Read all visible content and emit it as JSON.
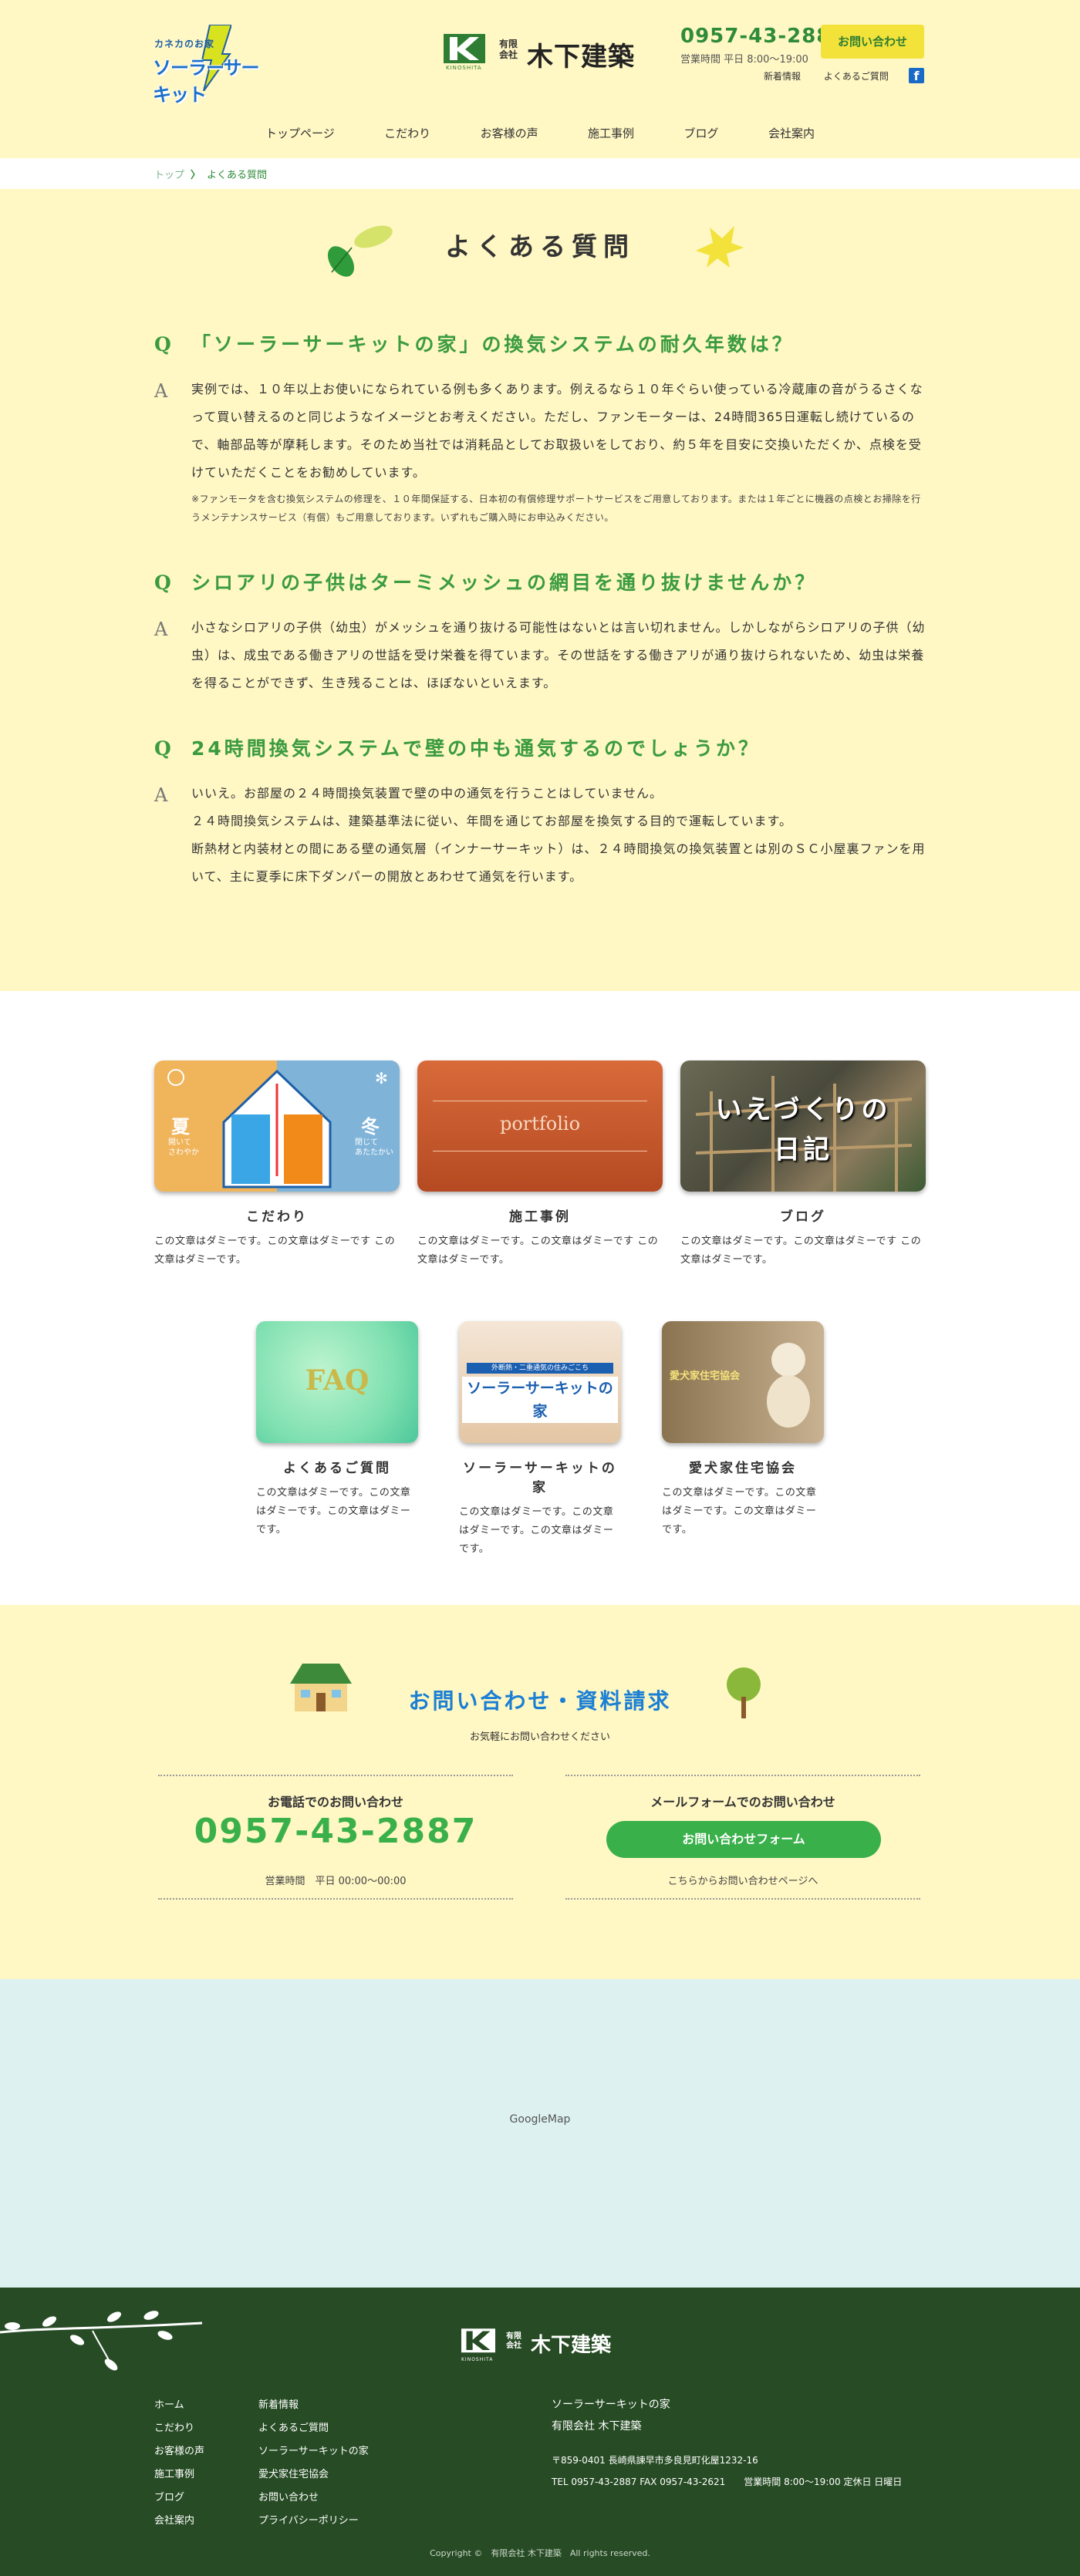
{
  "header": {
    "solar_logo_small": "カネカのお家",
    "solar_logo_big": "ソーラーサーキット",
    "company_kk": "有限\n会社",
    "company_name": "木下建築",
    "company_sub": "KINOSHITA",
    "tel": "0957-43-2887",
    "hours": "営業時間 平日 8:00〜19:00",
    "contact_button": "お問い合わせ",
    "link_news": "新着情報",
    "link_faq": "よくあるご質問",
    "facebook": "f"
  },
  "nav": [
    "トップページ",
    "こだわり",
    "お客様の声",
    "施工事例",
    "ブログ",
    "会社案内"
  ],
  "breadcrumb": {
    "home": "トップ",
    "sep": "〉",
    "current": "よくある質問"
  },
  "faq": {
    "title": "よくある質問",
    "q_mark": "Q",
    "a_mark": "A",
    "items": [
      {
        "q": "「ソーラーサーキットの家」の換気システムの耐久年数は？",
        "a": "実例では、１０年以上お使いになられている例も多くあります。例えるなら１０年ぐらい使っている冷蔵庫の音がうるさくなって買い替えるのと同じようなイメージとお考えください。ただし、ファンモーターは、24時間365日運転し続けているので、軸部品等が摩耗します。そのため当社では消耗品としてお取扱いをしており、約５年を目安に交換いただくか、点検を受けていただくことをお勧めしています。",
        "note": "※ファンモータを含む換気システムの修理を、１０年間保証する、日本初の有償修理サポートサービスをご用意しております。または１年ごとに機器の点検とお掃除を行うメンテナンスサービス（有償）もご用意しております。いずれもご購入時にお申込みください。"
      },
      {
        "q": "シロアリの子供はターミメッシュの網目を通り抜けませんか？",
        "a": "小さなシロアリの子供（幼虫）がメッシュを通り抜ける可能性はないとは言い切れません。しかしながらシロアリの子供（幼虫）は、成虫である働きアリの世話を受け栄養を得ています。その世話をする働きアリが通り抜けられないため、幼虫は栄養を得ることができず、生き残ることは、ほぼないといえます。",
        "note": ""
      },
      {
        "q": "24時間換気システムで壁の中も通気するのでしょうか？",
        "a1": "いいえ。お部屋の２４時間換気装置で壁の中の通気を行うことはしていません。",
        "a2": "２４時間換気システムは、建築基準法に従い、年間を通じてお部屋を換気する目的で運転しています。",
        "a3": "断熱材と内装材との間にある壁の通気層（インナーサーキット）は、２４時間換気の換気装置とは別のＳＣ小屋裏ファンを用いて、主に夏季に床下ダンパーの開放とあわせて通気を行います。"
      }
    ]
  },
  "cards": [
    {
      "title": "こだわり",
      "desc": "この文章はダミーです。この文章はダミーです この文章はダミーです。",
      "img_summer": "夏",
      "img_summer_sub": "開いて\nさわやか",
      "img_winter": "冬",
      "img_winter_sub": "閉じて\nあたたかい"
    },
    {
      "title": "施工事例",
      "desc": "この文章はダミーです。この文章はダミーです この文章はダミーです。",
      "img_text": "portfolio"
    },
    {
      "title": "ブログ",
      "desc": "この文章はダミーです。この文章はダミーです この文章はダミーです。",
      "img_text1": "いえづくりの",
      "img_text2": "日記"
    },
    {
      "title": "よくあるご質問",
      "desc": "この文章はダミーです。この文章はダミーです。この文章はダミーです。",
      "img_text": "FAQ"
    },
    {
      "title": "ソーラーサーキットの家",
      "desc": "この文章はダミーです。この文章はダミーです。この文章はダミーです。",
      "img_top": "外断熱・二重通気の住みごこち",
      "img_text": "ソーラーサーキットの家"
    },
    {
      "title": "愛犬家住宅協会",
      "desc": "この文章はダミーです。この文章はダミーです。この文章はダミーです。",
      "img_text": "愛犬家住宅協会"
    }
  ],
  "contact": {
    "title": "お問い合わせ・資料請求",
    "sub": "お気軽にお問い合わせください",
    "tel_head": "お電話でのお問い合わせ",
    "tel": "0957-43-2887",
    "tel_hours": "営業時間　平日 00:00〜00:00",
    "mail_head": "メールフォームでのお問い合わせ",
    "mail_button": "お問い合わせフォーム",
    "mail_note": "こちらからお問い合わせページへ"
  },
  "map": {
    "label": "GoogleMap"
  },
  "footer": {
    "company_kk": "有限\n会社",
    "company_name": "木下建築",
    "company_sub": "KINOSHITA",
    "col1": [
      "ホーム",
      "こだわり",
      "お客様の声",
      "施工事例",
      "ブログ",
      "会社案内"
    ],
    "col2": [
      "新着情報",
      "よくあるご質問",
      "ソーラーサーキットの家",
      "愛犬家住宅協会",
      "お問い合わせ",
      "プライバシーポリシー"
    ],
    "brand": "ソーラーサーキットの家",
    "company": "有限会社 木下建築",
    "address": "〒859-0401 長崎県諫早市多良見町化屋1232-16",
    "contact_line": "TEL 0957-43-2887 FAX 0957-43-2621　　営業時間 8:00〜19:00 定休日 日曜日",
    "copyright": "Copyright ©　有限会社 木下建築　All rights reserved."
  },
  "colors": {
    "cream": "#fff7c4",
    "green": "#3a9b3f",
    "dark_green": "#274c25",
    "map_bg": "#ddf1f1",
    "blue": "#1a7fd4"
  }
}
